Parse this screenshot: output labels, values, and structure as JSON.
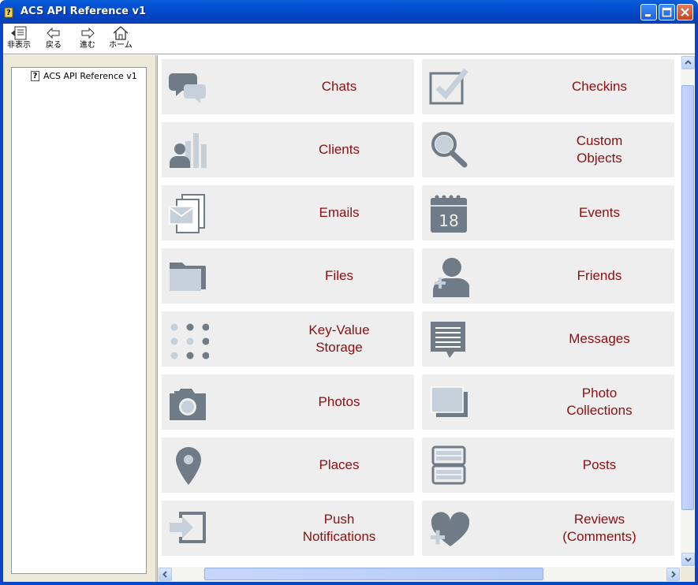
{
  "window": {
    "title": "ACS API Reference v1",
    "frame_color": "#0846c8"
  },
  "toolbar": {
    "buttons": [
      {
        "label": "非表示",
        "icon": "hide-pane-icon"
      },
      {
        "label": "戻る",
        "icon": "back-arrow-icon"
      },
      {
        "label": "進む",
        "icon": "forward-arrow-icon"
      },
      {
        "label": "ホーム",
        "icon": "home-icon"
      }
    ]
  },
  "tree": {
    "items": [
      {
        "label": "ACS API Reference v1",
        "icon": "help-page-icon"
      }
    ]
  },
  "tiles": [
    {
      "label": "Chats",
      "icon": "chat-bubbles-icon"
    },
    {
      "label": "Checkins",
      "icon": "checkbox-icon"
    },
    {
      "label": "Clients",
      "icon": "user-chart-icon"
    },
    {
      "label": "Custom\nObjects",
      "icon": "magnifier-icon"
    },
    {
      "label": "Emails",
      "icon": "envelope-stack-icon"
    },
    {
      "label": "Events",
      "icon": "calendar-icon",
      "icon_text": "18"
    },
    {
      "label": "Files",
      "icon": "folder-icon"
    },
    {
      "label": "Friends",
      "icon": "add-friend-icon"
    },
    {
      "label": "Key-Value\nStorage",
      "icon": "dot-grid-icon"
    },
    {
      "label": "Messages",
      "icon": "message-icon"
    },
    {
      "label": "Photos",
      "icon": "camera-icon"
    },
    {
      "label": "Photo\nCollections",
      "icon": "photo-stack-icon"
    },
    {
      "label": "Places",
      "icon": "map-pin-icon"
    },
    {
      "label": "Posts",
      "icon": "post-stack-icon"
    },
    {
      "label": "Push\nNotifications",
      "icon": "push-arrow-icon"
    },
    {
      "label": "Reviews\n(Comments)",
      "icon": "heart-plus-icon"
    }
  ],
  "colors": {
    "tile_bg": "#eeeeee",
    "label": "#8b0f0f",
    "icon_dark": "#6f7c87",
    "icon_light": "#c5d0da"
  }
}
